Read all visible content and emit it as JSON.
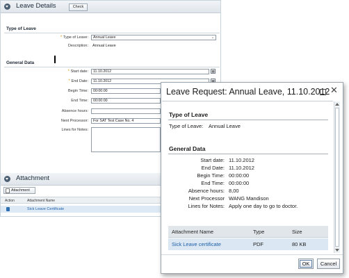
{
  "leave_details": {
    "title": "Leave Details",
    "check_label": "Check",
    "type_section": {
      "title": "Type of Leave",
      "type_label": "Type of Leave:",
      "type_value": "Annual Leave",
      "description_label": "Description:",
      "description_value": "Annual Leave"
    },
    "general_section": {
      "title": "General Data",
      "start_label": "Start date:",
      "start_value": "11.10.2012",
      "end_label": "End Date:",
      "end_value": "11.10.2012",
      "begin_time_label": "Begin Time:",
      "begin_time_value": "00:00:00",
      "end_time_label": "End Time:",
      "end_time_value": "00:00:00",
      "absence_label": "Absence hours:",
      "absence_value": "",
      "processor_label": "Next Processor:",
      "processor_value": "For SAT Test Case No. 4",
      "notes_label": "Lines for Notes:",
      "notes_value": ""
    },
    "attachment": {
      "title": "Attachment",
      "button_label": "Attachment",
      "columns": [
        "Action",
        "Attachment Name"
      ],
      "rows": [
        {
          "name": "Sick Leave Certificate"
        }
      ]
    }
  },
  "dialog": {
    "title": "Leave Request: Annual Leave, 11.10.2012",
    "type_section": {
      "title": "Type of Leave",
      "type_label": "Type of Leave:",
      "type_value": "Annual Leave"
    },
    "general_section": {
      "title": "General Data",
      "rows": [
        {
          "label": "Start date:",
          "value": "11.10.2012"
        },
        {
          "label": "End Date:",
          "value": "11.10.2012"
        },
        {
          "label": "Begin Time:",
          "value": "00:00:00"
        },
        {
          "label": "End Time:",
          "value": "00:00:00"
        },
        {
          "label": "Absence hours:",
          "value": "8,00"
        },
        {
          "label": "Next Processor",
          "value": "WANG Mandison"
        },
        {
          "label": "Lines for Notes:",
          "value": "Apply one day to go to doctor."
        }
      ]
    },
    "attachments": {
      "columns": [
        "Attachment Name",
        "Type",
        "Size"
      ],
      "rows": [
        {
          "name": "Sick Leave certificate",
          "type": "PDF",
          "size": "80 KB"
        }
      ]
    },
    "ok_label": "OK",
    "cancel_label": "Cancel"
  }
}
